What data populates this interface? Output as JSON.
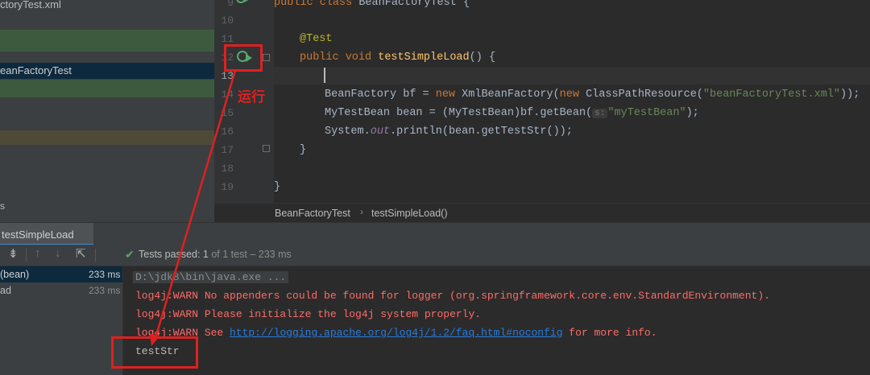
{
  "project": {
    "items": [
      {
        "label": "ctoryTest.xml"
      },
      {
        "label": "eanFactoryTest"
      },
      {
        "label": "s"
      }
    ]
  },
  "editor": {
    "lines": [
      {
        "n": "9"
      },
      {
        "n": "10"
      },
      {
        "n": "11"
      },
      {
        "n": "12"
      },
      {
        "n": "13"
      },
      {
        "n": "14"
      },
      {
        "n": "15"
      },
      {
        "n": "16"
      },
      {
        "n": "17"
      },
      {
        "n": "18"
      },
      {
        "n": "19"
      }
    ],
    "code": {
      "l9_kw": "public class ",
      "l9_rest": "BeanFactoryTest {",
      "l11_ann": "@Test",
      "l12_kw": "public void ",
      "l12_fn": "testSimpleLoad",
      "l12_rest": "() {",
      "l14_a": "BeanFactory bf = ",
      "l14_kw1": "new ",
      "l14_b": "XmlBeanFactory(",
      "l14_kw2": "new ",
      "l14_c": "ClassPathResource(",
      "l14_str": "\"beanFactoryTest.xml\"",
      "l14_d": "));",
      "l15_a": "MyTestBean bean = (MyTestBean)bf.getBean(",
      "l15_hint": "s:",
      "l15_str": "\"myTestBean\"",
      "l15_b": ");",
      "l16_a": "System.",
      "l16_it": "out",
      "l16_b": ".println(bean.getTestStr());",
      "l17": "}",
      "l19": "}"
    },
    "breadcrumb": [
      "BeanFactoryTest",
      "testSimpleLoad()"
    ]
  },
  "annotation": {
    "run_label": "运行"
  },
  "run_panel": {
    "tab_label": "testSimpleLoad",
    "status_prefix": "Tests passed:",
    "status_count": "1",
    "status_suffix": "of 1 test",
    "status_time": "– 233 ms",
    "tree": [
      {
        "label": "(bean)",
        "time": "233 ms"
      },
      {
        "label": "ad",
        "time": "233 ms"
      }
    ],
    "console": {
      "cmd": "D:\\jdk8\\bin\\java.exe ...",
      "warn1": "log4j:WARN No appenders could be found for logger (org.springframework.core.env.StandardEnvironment).",
      "warn2": "log4j:WARN Please initialize the log4j system properly.",
      "warn3_prefix": "log4j:WARN See ",
      "warn3_link": "http://logging.apache.org/log4j/1.2/faq.html#noconfig",
      "warn3_suffix": " for more info.",
      "output": "testStr"
    }
  },
  "colors": {
    "accent_red": "#e02020",
    "pass_green": "#59a869",
    "selection": "#0d293e"
  }
}
